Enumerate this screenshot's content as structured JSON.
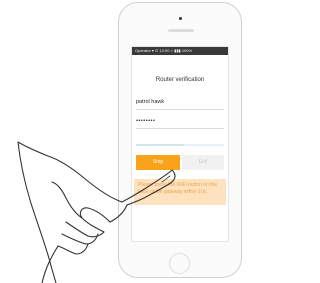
{
  "status_bar": {
    "text": "Operator ▾ ⊙ 12:00 ⌂ ▮▮▮ 100%"
  },
  "screen": {
    "title": "Router verification",
    "username_value": "patrol hawk",
    "password_value": "••••••••",
    "progress": 0.55,
    "stop_label": "Stop",
    "exit_label": "Exit",
    "notice": "Please press the WiFi button on the back of the gateway within 10s."
  },
  "colors": {
    "accent": "#f9a21a",
    "notice_bg": "#fde2bf",
    "notice_text": "#f2a24a"
  }
}
